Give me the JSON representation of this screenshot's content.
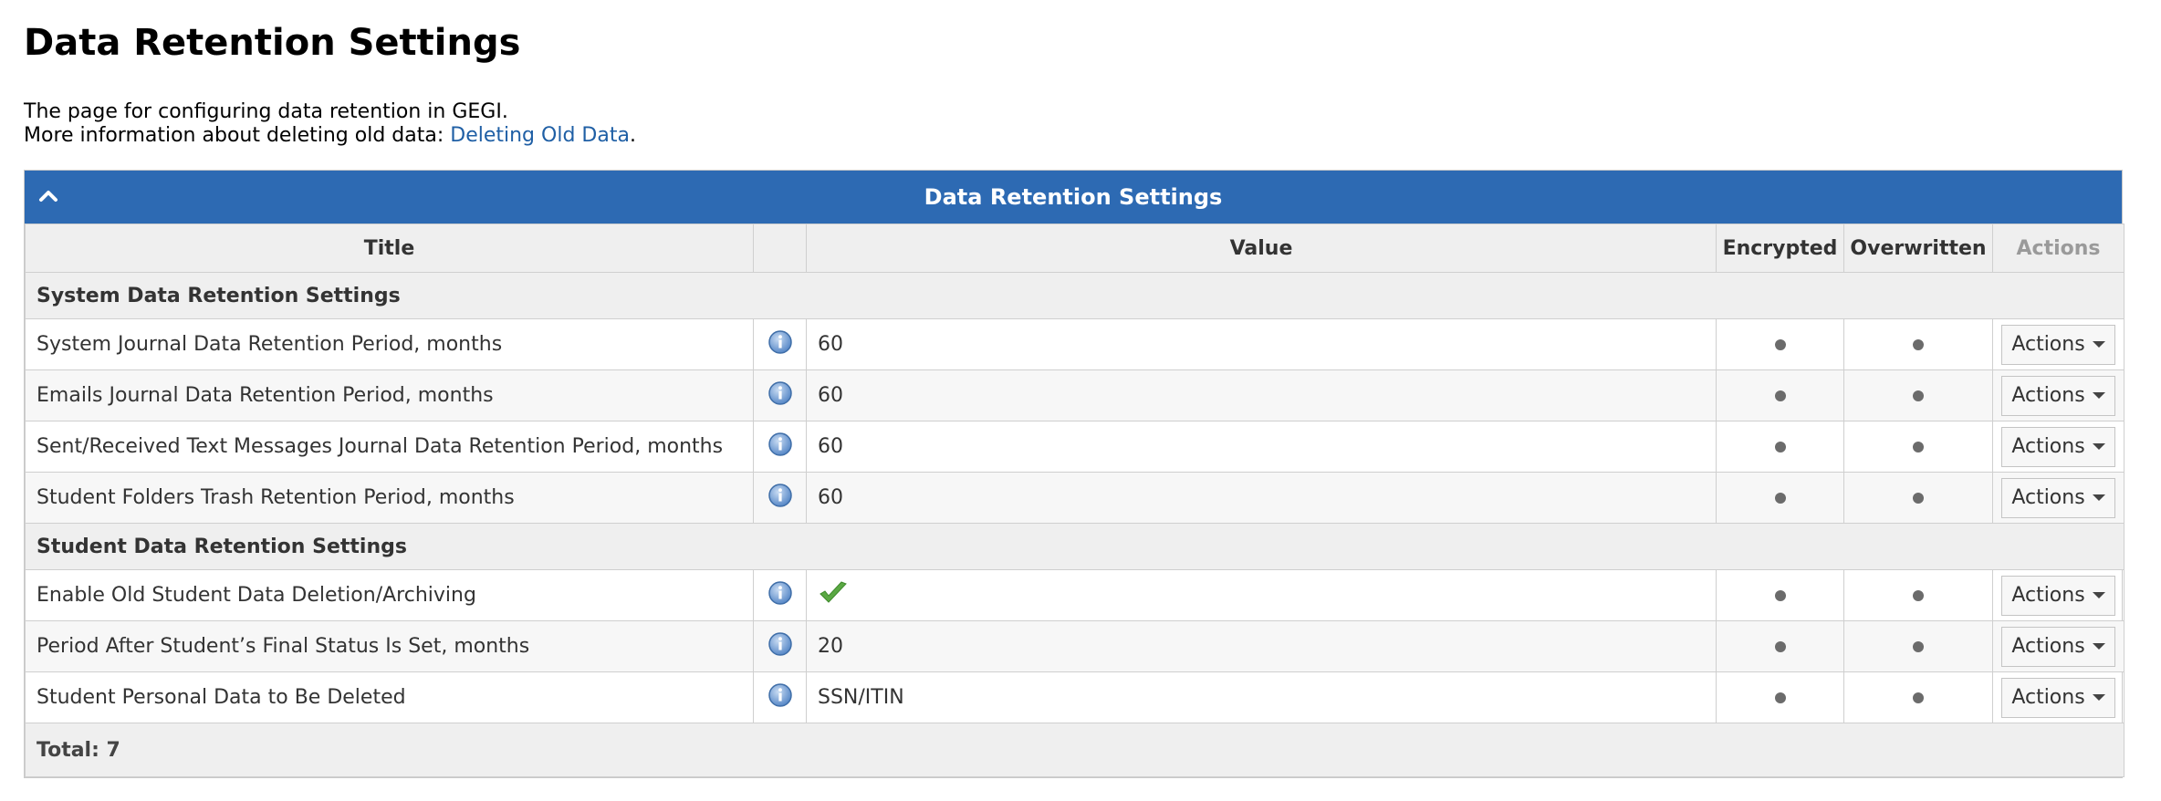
{
  "page": {
    "title": "Data Retention Settings",
    "intro_line1": "The page for configuring data retention in GEGI.",
    "intro_line2_prefix": "More information about deleting old data: ",
    "intro_link": "Deleting Old Data",
    "intro_line2_suffix": "."
  },
  "panel": {
    "header": "Data Retention Settings",
    "columns": {
      "title": "Title",
      "info": "",
      "value": "Value",
      "encrypted": "Encrypted",
      "overwritten": "Overwritten",
      "actions": "Actions"
    },
    "groups": [
      {
        "label": "System Data Retention Settings",
        "rows": [
          {
            "title": "System Journal Data Retention Period, months",
            "value": "60",
            "actions": "Actions"
          },
          {
            "title": "Emails Journal Data Retention Period, months",
            "value": "60",
            "actions": "Actions"
          },
          {
            "title": "Sent/Received Text Messages Journal Data Retention Period, months",
            "value": "60",
            "actions": "Actions"
          },
          {
            "title": "Student Folders Trash Retention Period, months",
            "value": "60",
            "actions": "Actions"
          }
        ]
      },
      {
        "label": "Student Data Retention Settings",
        "rows": [
          {
            "title": "Enable Old Student Data Deletion/Archiving",
            "value": "",
            "value_icon": "checkmark-icon",
            "actions": "Actions"
          },
          {
            "title": "Period After Student’s Final Status Is Set, months",
            "value": "20",
            "actions": "Actions"
          },
          {
            "title": "Student Personal Data to Be Deleted",
            "value": "SSN/ITIN",
            "actions": "Actions"
          }
        ]
      }
    ],
    "total": "Total: 7"
  },
  "colors": {
    "header_blue": "#2d6ab3",
    "link_blue": "#1f5fa5",
    "check_green": "#5aa843",
    "info_blue": "#5b8fd0"
  }
}
